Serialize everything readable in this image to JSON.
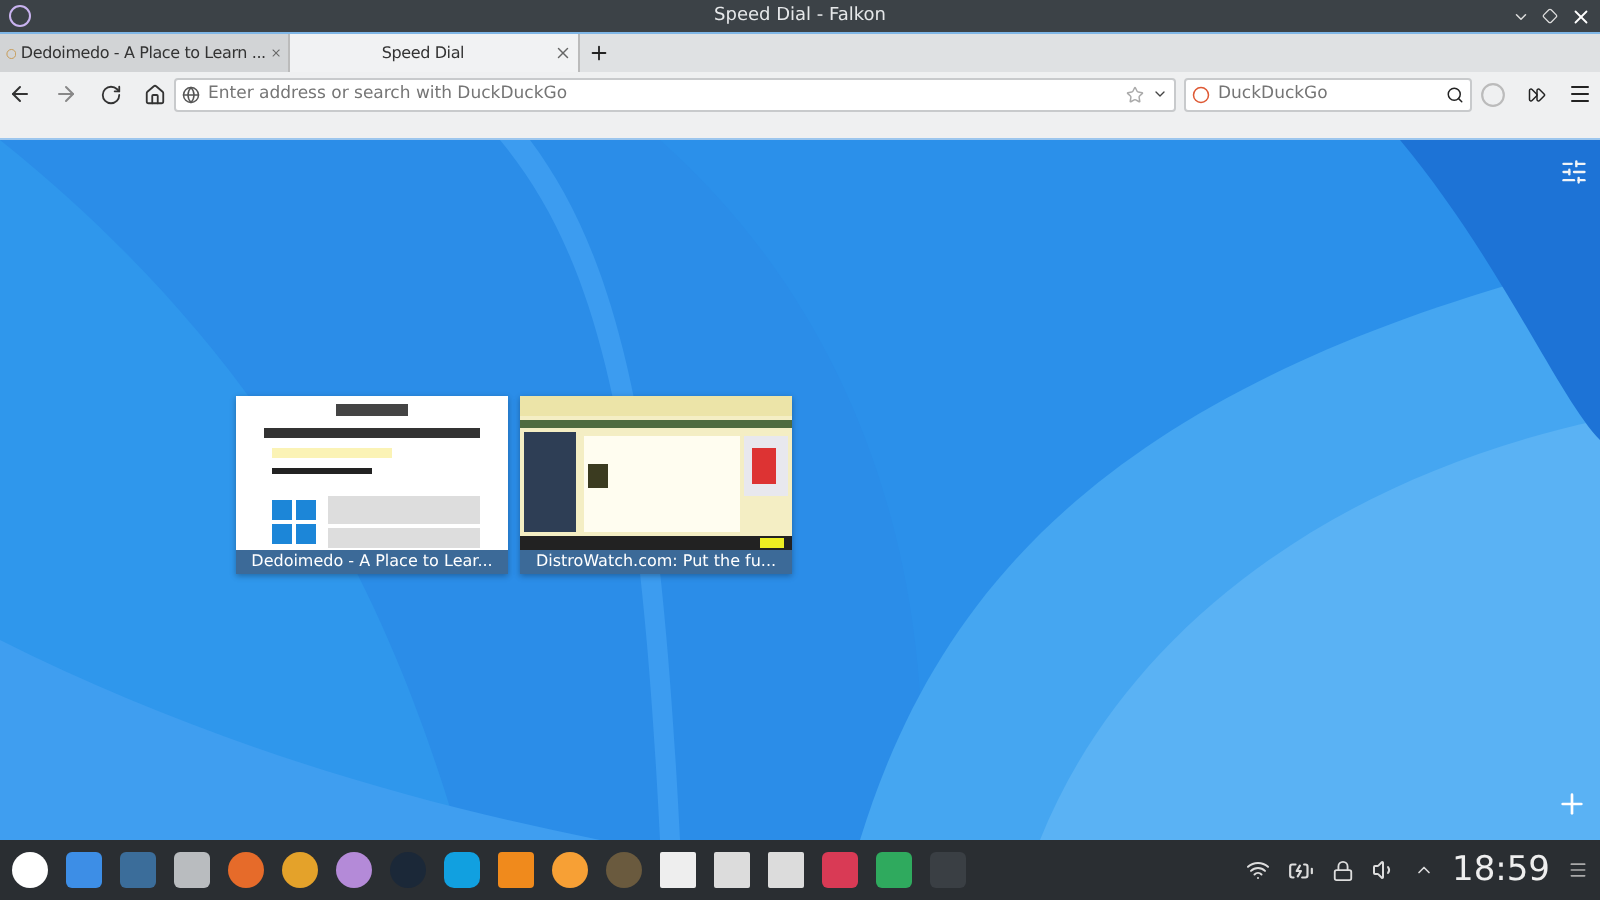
{
  "window": {
    "title": "Speed Dial - Falkon"
  },
  "tabs": [
    {
      "label": "Dedoimedo - A Place to Learn ...",
      "selected": false
    },
    {
      "label": "Speed Dial",
      "selected": true
    }
  ],
  "address_bar": {
    "placeholder": "Enter address or search with DuckDuckGo"
  },
  "search_field": {
    "placeholder": "DuckDuckGo"
  },
  "speed_dial": [
    {
      "title": "Dedoimedo - A Place to Lear...",
      "kind": "light"
    },
    {
      "title": "DistroWatch.com: Put the fu...",
      "kind": "busy"
    }
  ],
  "taskbar": {
    "clock": "18:59"
  }
}
